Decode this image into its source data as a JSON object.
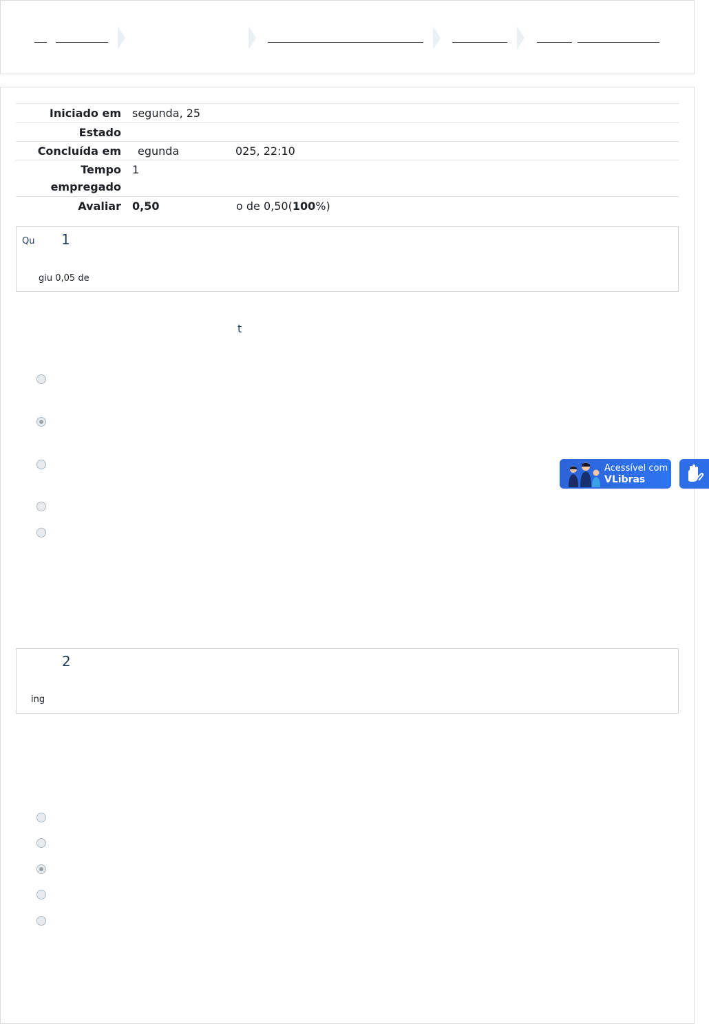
{
  "summary": {
    "rows": [
      {
        "label": "Iniciado em",
        "value": "segunda, 25"
      },
      {
        "label": "Estado",
        "value": ""
      },
      {
        "label": "Concluída em",
        "value": "egunda",
        "value2": "025, 22:10"
      },
      {
        "label": "Tempo",
        "label2": "empregado",
        "value": "1"
      },
      {
        "label": "Avaliar",
        "value": "0,50",
        "value2": "o de 0,50",
        "value3": "100"
      }
    ]
  },
  "questions": [
    {
      "number": "1",
      "prefix": "Qu",
      "grade_text": "giu 0,05 de",
      "body_fragment": "t",
      "options_count": 5,
      "selected": 2
    },
    {
      "number": "2",
      "grade_text": "ing",
      "options_count": 5,
      "selected": 3
    }
  ],
  "vlibras": {
    "line1": "Acessível com",
    "line2": "VLibras"
  },
  "colors": {
    "accent": "#1f3b57",
    "vlibras_blue": "#2d6ee8"
  }
}
